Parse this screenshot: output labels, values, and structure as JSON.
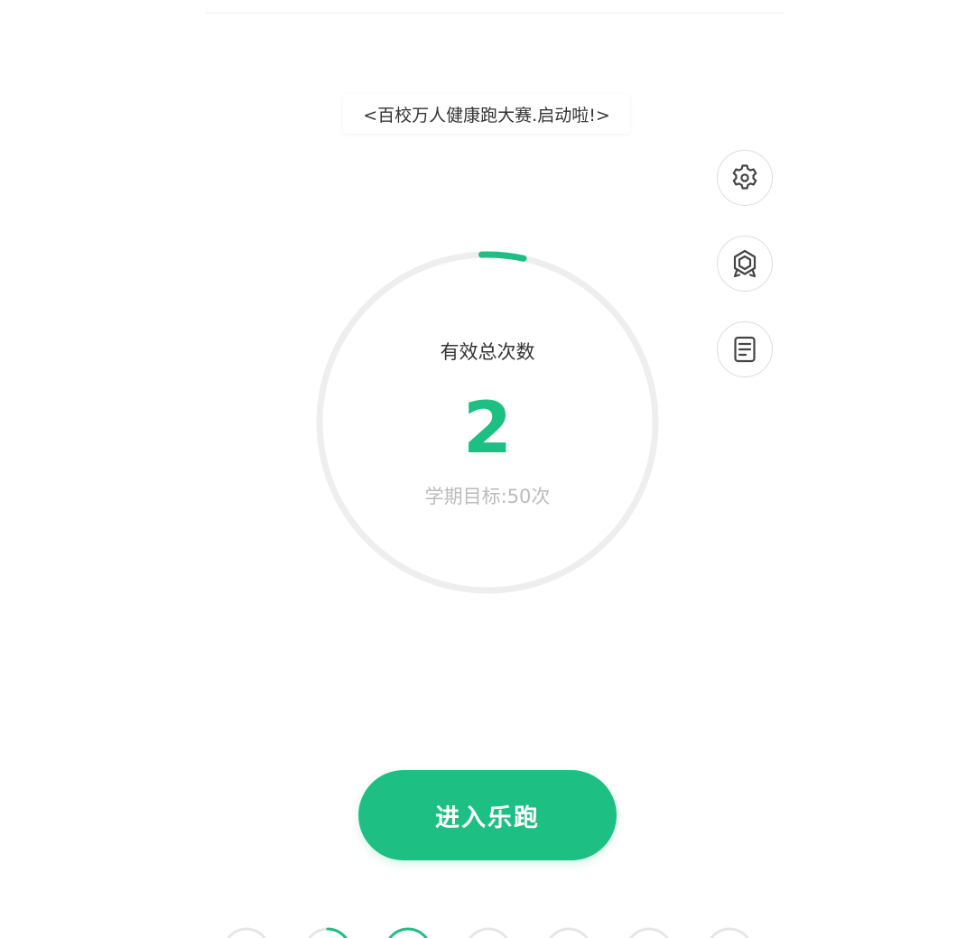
{
  "banner": {
    "text": "<百校万人健康跑大赛.启动啦!>"
  },
  "side_buttons": [
    {
      "icon": "gear-icon"
    },
    {
      "icon": "badge-icon"
    },
    {
      "icon": "document-icon"
    }
  ],
  "progress": {
    "label": "有效总次数",
    "count": "2",
    "goal_text": "学期目标:50次",
    "count_value": 2,
    "goal_value": 50
  },
  "enter_button": {
    "label": "进入乐跑"
  },
  "colors": {
    "accent": "#1dbf83",
    "ring_track": "#eeeeee",
    "text_dark": "#333333",
    "text_muted": "#bbbbbb"
  }
}
